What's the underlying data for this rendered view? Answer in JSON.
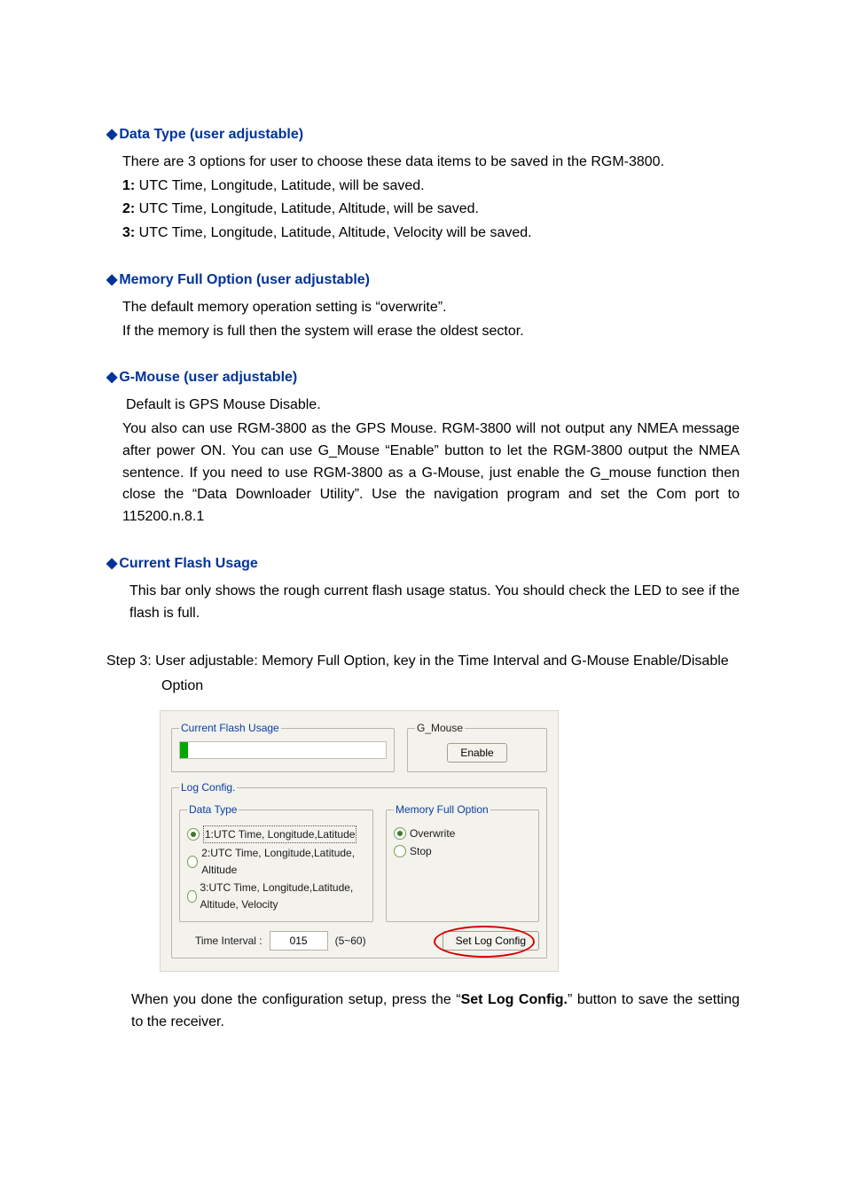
{
  "sections": {
    "dataType": {
      "heading": "Data Type (user adjustable)",
      "p1": "There are 3 options for user to choose these data items to be saved in the RGM-3800.",
      "l1a": "1:",
      "l1b": " UTC Time, Longitude, Latitude, will be saved.",
      "l2a": "2:",
      "l2b": " UTC Time, Longitude, Latitude, Altitude, will be saved.",
      "l3a": "3:",
      "l3b": " UTC Time, Longitude, Latitude, Altitude, Velocity will be saved."
    },
    "memFull": {
      "heading": "Memory Full Option (user adjustable)",
      "p1": "The default memory operation setting is “overwrite”.",
      "p2": "If the memory is full then the system will erase the oldest sector."
    },
    "gmouse": {
      "heading": "G-Mouse (user adjustable)",
      "p1": "Default is GPS Mouse Disable.",
      "p2": "You also can use RGM-3800 as the GPS Mouse. RGM-3800 will not output any NMEA message after power ON. You can use G_Mouse “Enable” button to let the RGM-3800 output the NMEA sentence. If you need to use RGM-3800 as a G-Mouse, just enable the G_mouse function then close the “Data Downloader Utility”. Use the navigation program and set the Com port to 115200.n.8.1"
    },
    "flash": {
      "heading": "Current Flash Usage",
      "p1": "This bar only shows the rough current flash usage status. You should check the LED to see if the flash is full."
    },
    "step3": "Step 3: User adjustable: Memory Full Option, key in the Time Interval and G-Mouse Enable/Disable Option",
    "afterDialog": {
      "pre": "When you done the configuration setup, press the “",
      "bold": "Set Log Config.",
      "post": "” button to save the setting to the receiver."
    }
  },
  "dialog": {
    "flashLegend": "Current Flash Usage",
    "gmouseLegend": "G_Mouse",
    "enableBtn": "Enable",
    "logLegend": "Log Config.",
    "dataTypeLegend": "Data Type",
    "memLegend": "Memory Full Option",
    "dt1": "1:UTC Time, Longitude,Latitude",
    "dt2": "2:UTC Time, Longitude,Latitude, Altitude",
    "dt3": "3:UTC Time, Longitude,Latitude, Altitude, Velocity",
    "mem1": "Overwrite",
    "mem2": "Stop",
    "timeLabel": "Time Interval :",
    "timeValue": "015",
    "timeRange": "(5~60)",
    "setLog": "Set Log Config"
  }
}
